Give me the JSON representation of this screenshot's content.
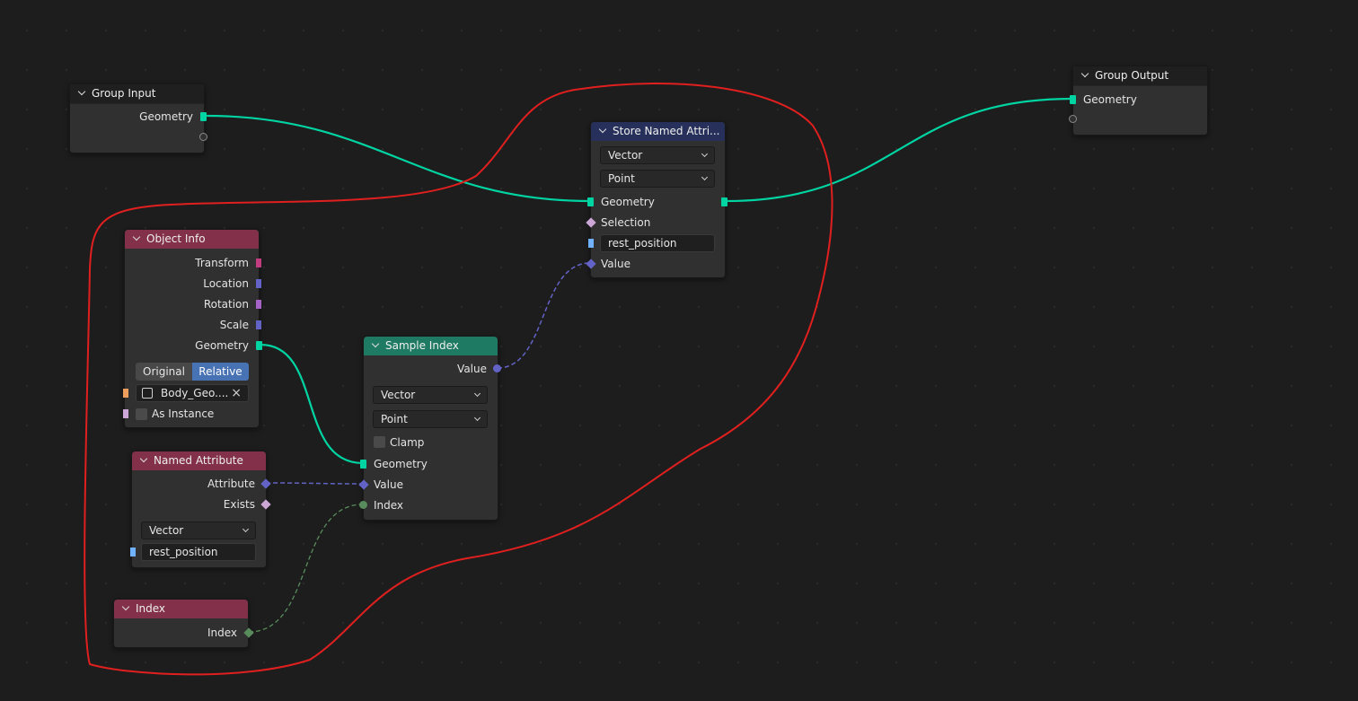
{
  "colors": {
    "geometry_socket": "#00d4a2",
    "vector_socket": "#6363c7",
    "boolean_socket": "#cca6d6",
    "string_socket": "#70b2ff",
    "integer_socket": "#598c5c",
    "object_socket": "#ed9e5c",
    "matrix_socket": "#c23d80",
    "rotation_socket": "#a663c7",
    "annotation_stroke": "#e01f1f",
    "selected_toggle": "#4772b3"
  },
  "group_input": {
    "title": "Group Input",
    "outputs": [
      "Geometry"
    ]
  },
  "group_output": {
    "title": "Group Output",
    "inputs": [
      "Geometry"
    ]
  },
  "object_info": {
    "title": "Object Info",
    "outputs": [
      "Transform",
      "Location",
      "Rotation",
      "Scale",
      "Geometry"
    ],
    "toggle": {
      "off": "Original",
      "on": "Relative",
      "selected": "Relative"
    },
    "object_value": "Body_Geo....",
    "as_instance_label": "As Instance"
  },
  "named_attribute": {
    "title": "Named Attribute",
    "outputs": [
      "Attribute",
      "Exists"
    ],
    "data_type": "Vector",
    "name_value": "rest_position"
  },
  "index_node": {
    "title": "Index",
    "outputs": [
      "Index"
    ]
  },
  "sample_index": {
    "title": "Sample Index",
    "output": "Value",
    "data_type": "Vector",
    "domain": "Point",
    "clamp_label": "Clamp",
    "inputs": [
      "Geometry",
      "Value",
      "Index"
    ]
  },
  "store_named": {
    "title": "Store Named Attri...",
    "data_type": "Vector",
    "domain": "Point",
    "inputs": [
      "Geometry",
      "Selection"
    ],
    "name_value": "rest_position",
    "value_label": "Value"
  }
}
